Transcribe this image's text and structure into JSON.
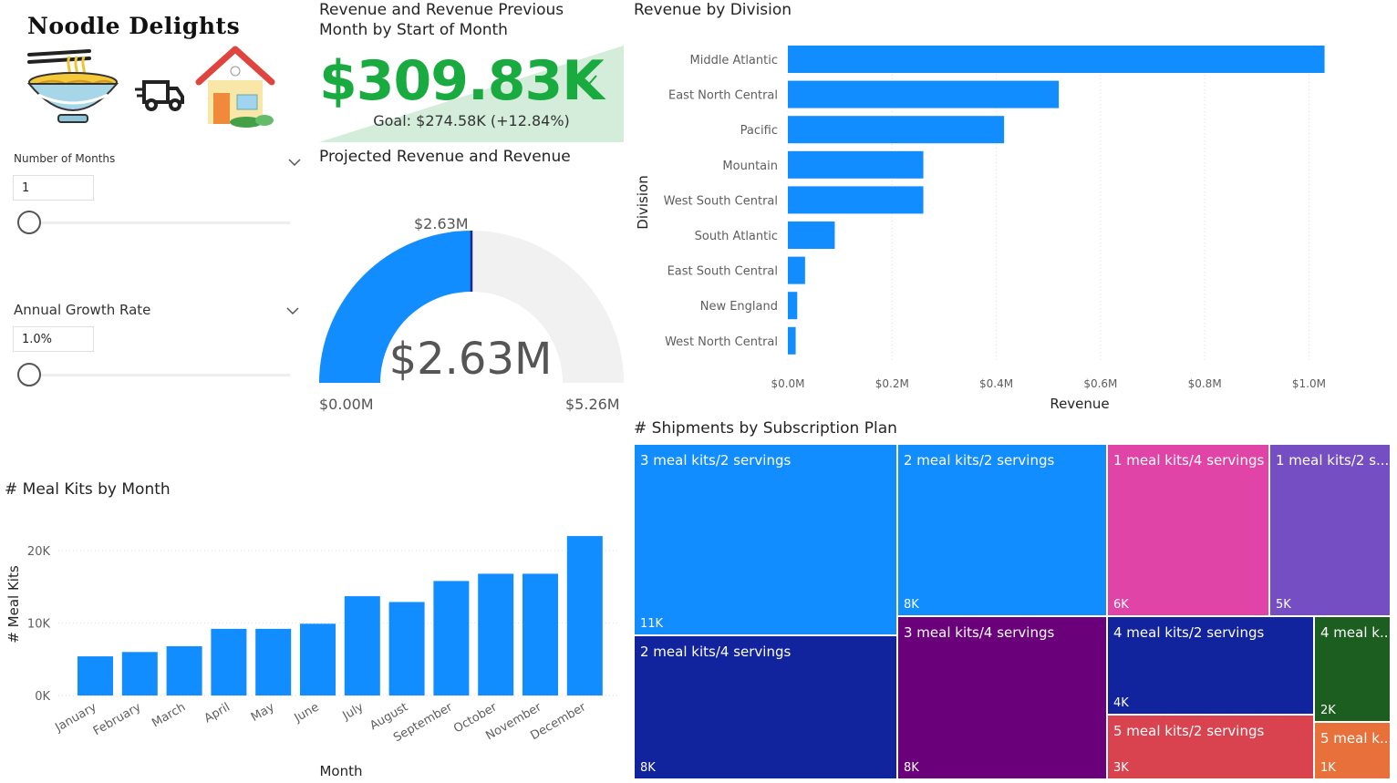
{
  "logo": {
    "title": "Noodle Delights",
    "icons": [
      "noodle-bowl-icon",
      "delivery-truck-icon",
      "house-icon"
    ]
  },
  "slicers": {
    "months": {
      "label": "Number of Months",
      "value": "1"
    },
    "growth": {
      "label": "Annual Growth Rate",
      "value": "1.0%"
    }
  },
  "kpi": {
    "title_line1": "Revenue and Revenue Previous",
    "title_line2": "Month by Start of Month",
    "value": "$309.83K",
    "goal": "Goal: $274.58K (+12.84%)",
    "status_color": "#1AAB40"
  },
  "gauge": {
    "title": "Projected Revenue and Revenue",
    "value_label": "$2.63M",
    "target_label": "$2.63M",
    "min_label": "$0.00M",
    "max_label": "$5.26M",
    "fraction": 0.5,
    "fill_color": "#118DFF"
  },
  "division_chart": {
    "chart_data": {
      "type": "bar",
      "orientation": "horizontal",
      "title": "Revenue by Division",
      "xlabel": "Revenue",
      "ylabel": "Division",
      "categories": [
        "Middle Atlantic",
        "East North Central",
        "Pacific",
        "Mountain",
        "West South Central",
        "South Atlantic",
        "East South Central",
        "New England",
        "West North Central"
      ],
      "values": [
        1.03,
        0.52,
        0.415,
        0.26,
        0.26,
        0.09,
        0.033,
        0.018,
        0.015
      ],
      "value_unit": "$M",
      "xlim": [
        0,
        1.05
      ],
      "xticks": [
        "$0.0M",
        "$0.2M",
        "$0.4M",
        "$0.6M",
        "$0.8M",
        "$1.0M"
      ],
      "xtick_values": [
        0,
        0.2,
        0.4,
        0.6,
        0.8,
        1.0
      ],
      "grid": true,
      "color": "#118DFF"
    }
  },
  "meal_kits_chart": {
    "chart_data": {
      "type": "bar",
      "title": "# Meal Kits by Month",
      "xlabel": "Month",
      "ylabel": "# Meal Kits",
      "categories": [
        "January",
        "February",
        "March",
        "April",
        "May",
        "June",
        "July",
        "August",
        "September",
        "October",
        "November",
        "December"
      ],
      "values": [
        5400,
        6000,
        6800,
        9200,
        9200,
        9900,
        13700,
        12900,
        15800,
        16800,
        16800,
        22000
      ],
      "ylim": [
        0,
        22000
      ],
      "yticks": [
        "0K",
        "10K",
        "20K"
      ],
      "ytick_values": [
        0,
        10000,
        20000
      ],
      "grid": true,
      "color": "#118DFF"
    }
  },
  "treemap": {
    "title": "# Shipments by Subscription Plan",
    "chart_data": {
      "type": "treemap",
      "items": [
        {
          "label": "3 meal kits/2 servings",
          "value": "11K",
          "color": "#118DFF"
        },
        {
          "label": "2 meal kits/4 servings",
          "value": "8K",
          "color": "#12239E"
        },
        {
          "label": "2 meal kits/2 servings",
          "value": "8K",
          "color": "#118DFF"
        },
        {
          "label": "3 meal kits/4 servings",
          "value": "8K",
          "color": "#6B007B"
        },
        {
          "label": "1 meal kits/4 servings",
          "value": "6K",
          "color": "#E044A7"
        },
        {
          "label": "4 meal kits/2 servings",
          "value": "4K",
          "color": "#12239E"
        },
        {
          "label": "5 meal kits/2 servings",
          "value": "3K",
          "color": "#D9434F"
        },
        {
          "label": "1 meal kits/2 s...",
          "value": "5K",
          "color": "#744EC2"
        },
        {
          "label": "4 meal k...",
          "value": "2K",
          "color": "#1B5E20"
        },
        {
          "label": "5 meal k...",
          "value": "1K",
          "color": "#E8703A"
        }
      ]
    }
  }
}
